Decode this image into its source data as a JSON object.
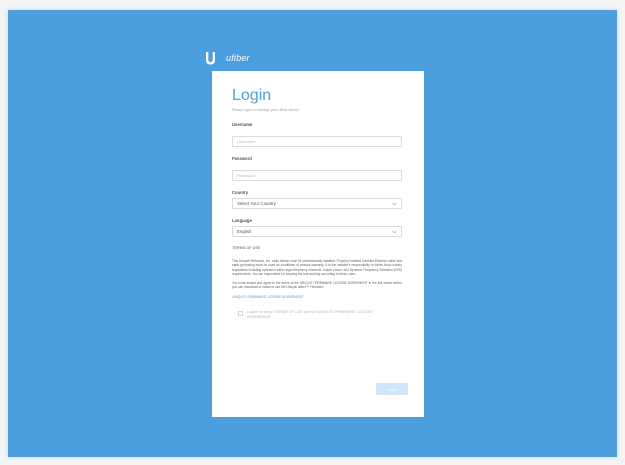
{
  "brand": {
    "logo_icon": "ubiquiti-u-icon",
    "product_name": "ufiber"
  },
  "login": {
    "title": "Login",
    "subtitle": "Please login to manage your ufiber device",
    "username": {
      "label": "Username",
      "placeholder": "Username"
    },
    "password": {
      "label": "Password",
      "placeholder": "Password"
    },
    "country": {
      "label": "Country",
      "selected": "Select Your Country"
    },
    "language": {
      "label": "Language",
      "selected": "English"
    },
    "terms_heading": "TERMS OF USE",
    "terms_paragraph_1": "This Ubiquiti Networks, Inc. radio device must be professionally installed. Properly installed shielded Ethernet cable and earth grounding must be used as conditions of product warranty. It is the installer's responsibility to follow local country regulations including operation within legal frequency channels, output power, and Dynamic Frequency Selection (DFS) requirements. You are responsible for keeping the unit working according to these rules.",
    "terms_paragraph_2": "You must accept and agree to the terms of the UBIQUITI FIRMWARE LICENSE AGREEMENT in the link below before you can download or install or use the Ubiquiti ufiber™ Firmware.",
    "license_link": "UBIQUITI FIRMWARE LICENSE AGREEMENT",
    "agree_text": "I agree to these TERMS OF USE and the UBIQUITI FIRMWARE LICENSE AGREEMENT",
    "login_button": "Login"
  },
  "colors": {
    "background": "#4b9fdf",
    "accent": "#4aa3df",
    "button_disabled": "#cfe6f6"
  }
}
